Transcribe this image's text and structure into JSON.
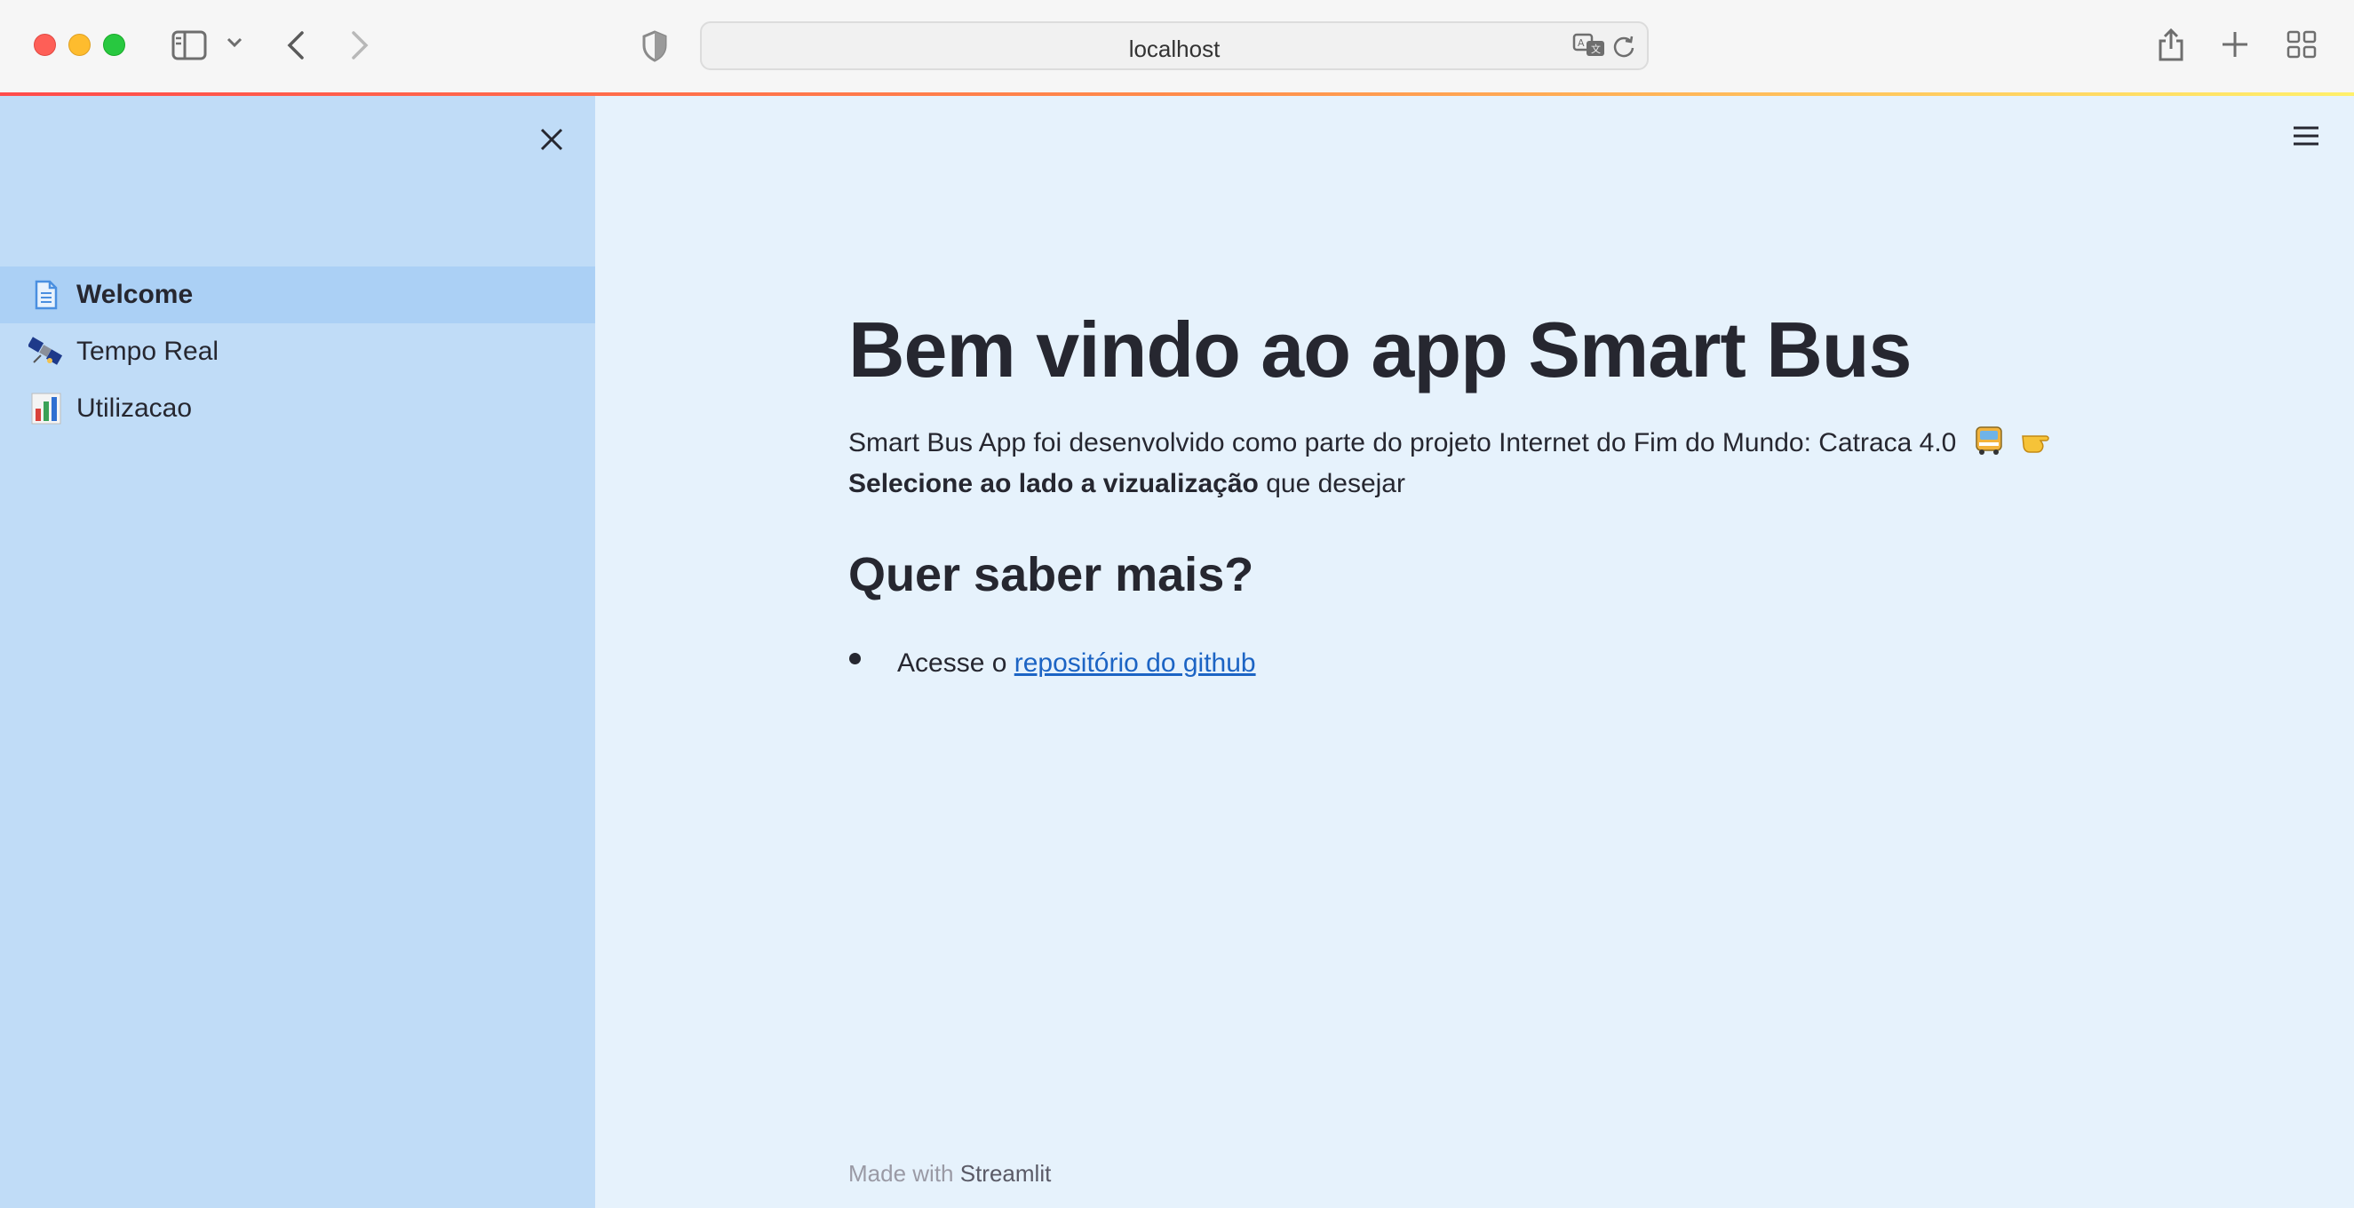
{
  "browser": {
    "url": "localhost"
  },
  "sidebar": {
    "items": [
      {
        "label": "Welcome",
        "icon": "document-icon",
        "active": true
      },
      {
        "label": "Tempo Real",
        "icon": "satellite-icon",
        "active": false
      },
      {
        "label": "Utilizacao",
        "icon": "bar-chart-icon",
        "active": false
      }
    ]
  },
  "main": {
    "title": "Bem vindo ao app Smart Bus",
    "intro": "Smart Bus App foi desenvolvido como parte do projeto Internet do Fim do Mundo: Catraca 4.0",
    "select_bold": "Selecione ao lado a vizualização",
    "select_rest": " que desejar",
    "subheading": "Quer saber mais?",
    "list_prefix": "Acesse o ",
    "list_link": "repositório do github"
  },
  "footer": {
    "made_with": "Made with ",
    "brand": "Streamlit"
  },
  "colors": {
    "sidebar_bg": "#c0dcf7",
    "main_bg": "#e6f2fc",
    "active_item_bg": "#abd0f5",
    "link": "#1c64c4"
  }
}
